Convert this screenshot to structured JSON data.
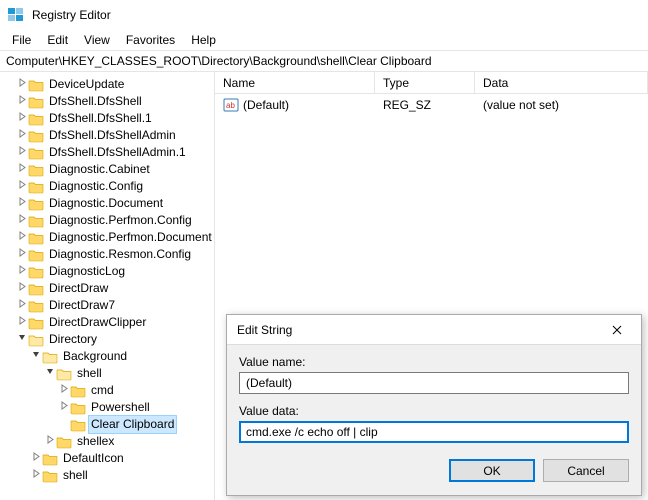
{
  "window": {
    "title": "Registry Editor"
  },
  "menu": {
    "file": "File",
    "edit": "Edit",
    "view": "View",
    "favorites": "Favorites",
    "help": "Help"
  },
  "address": "Computer\\HKEY_CLASSES_ROOT\\Directory\\Background\\shell\\Clear Clipboard",
  "columns": {
    "name": "Name",
    "type": "Type",
    "data": "Data"
  },
  "values": [
    {
      "name": "(Default)",
      "type": "REG_SZ",
      "data": "(value not set)"
    }
  ],
  "tree": [
    {
      "depth": 1,
      "exp": "closed",
      "label": "DeviceUpdate"
    },
    {
      "depth": 1,
      "exp": "closed",
      "label": "DfsShell.DfsShell"
    },
    {
      "depth": 1,
      "exp": "closed",
      "label": "DfsShell.DfsShell.1"
    },
    {
      "depth": 1,
      "exp": "closed",
      "label": "DfsShell.DfsShellAdmin"
    },
    {
      "depth": 1,
      "exp": "closed",
      "label": "DfsShell.DfsShellAdmin.1"
    },
    {
      "depth": 1,
      "exp": "closed",
      "label": "Diagnostic.Cabinet"
    },
    {
      "depth": 1,
      "exp": "closed",
      "label": "Diagnostic.Config"
    },
    {
      "depth": 1,
      "exp": "closed",
      "label": "Diagnostic.Document"
    },
    {
      "depth": 1,
      "exp": "closed",
      "label": "Diagnostic.Perfmon.Config"
    },
    {
      "depth": 1,
      "exp": "closed",
      "label": "Diagnostic.Perfmon.Document"
    },
    {
      "depth": 1,
      "exp": "closed",
      "label": "Diagnostic.Resmon.Config"
    },
    {
      "depth": 1,
      "exp": "closed",
      "label": "DiagnosticLog"
    },
    {
      "depth": 1,
      "exp": "closed",
      "label": "DirectDraw"
    },
    {
      "depth": 1,
      "exp": "closed",
      "label": "DirectDraw7"
    },
    {
      "depth": 1,
      "exp": "closed",
      "label": "DirectDrawClipper"
    },
    {
      "depth": 1,
      "exp": "open",
      "label": "Directory"
    },
    {
      "depth": 2,
      "exp": "open",
      "label": "Background"
    },
    {
      "depth": 3,
      "exp": "open",
      "label": "shell"
    },
    {
      "depth": 4,
      "exp": "closed",
      "label": "cmd"
    },
    {
      "depth": 4,
      "exp": "closed",
      "label": "Powershell"
    },
    {
      "depth": 4,
      "exp": "none",
      "label": "Clear Clipboard",
      "selected": true
    },
    {
      "depth": 3,
      "exp": "closed",
      "label": "shellex"
    },
    {
      "depth": 2,
      "exp": "closed",
      "label": "DefaultIcon"
    },
    {
      "depth": 2,
      "exp": "closed",
      "label": "shell"
    }
  ],
  "dialog": {
    "title": "Edit String",
    "value_name_label": "Value name:",
    "value_name": "(Default)",
    "value_data_label": "Value data:",
    "value_data": "cmd.exe /c echo off | clip",
    "ok": "OK",
    "cancel": "Cancel"
  }
}
